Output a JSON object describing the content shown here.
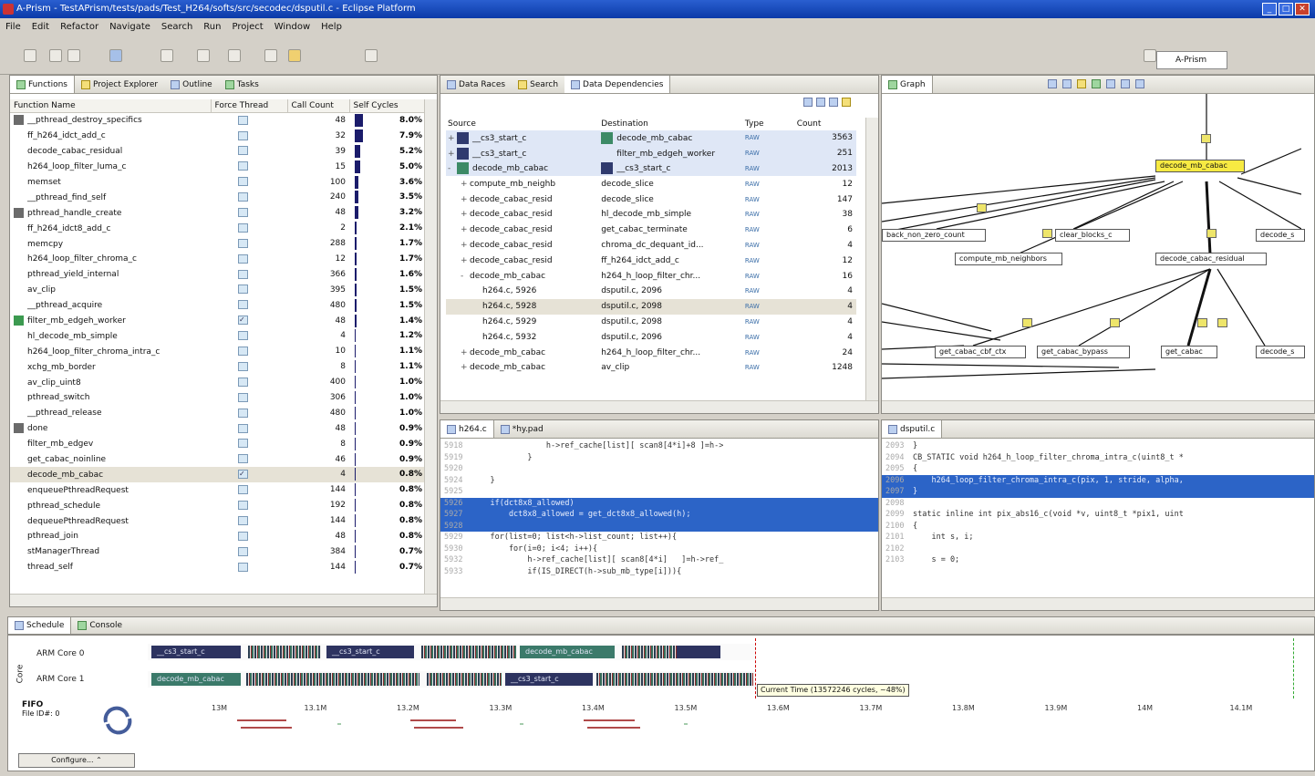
{
  "window": {
    "title": "A-Prism - TestAPrism/tests/pads/Test_H264/softs/src/secodec/dsputil.c - Eclipse Platform"
  },
  "menu": [
    "File",
    "Edit",
    "Refactor",
    "Navigate",
    "Search",
    "Run",
    "Project",
    "Window",
    "Help"
  ],
  "perspective": "A-Prism",
  "functions_panel": {
    "tabs": [
      "Functions",
      "Project Explorer",
      "Outline",
      "Tasks"
    ],
    "headers": [
      "Function Name",
      "Force Thread",
      "Call Count",
      "Self Cycles"
    ],
    "rows": [
      {
        "name": "__pthread_destroy_specifics",
        "color": "#6b6b6b",
        "forced": false,
        "calls": "48",
        "pct": "8.0%",
        "bar": 0.9
      },
      {
        "name": "ff_h264_idct_add_c",
        "color": "",
        "forced": false,
        "calls": "32",
        "pct": "7.9%",
        "bar": 0.88
      },
      {
        "name": "decode_cabac_residual",
        "color": "",
        "forced": false,
        "calls": "39",
        "pct": "5.2%",
        "bar": 0.58
      },
      {
        "name": "h264_loop_filter_luma_c",
        "color": "",
        "forced": false,
        "calls": "15",
        "pct": "5.0%",
        "bar": 0.56
      },
      {
        "name": "memset",
        "color": "",
        "forced": false,
        "calls": "100",
        "pct": "3.6%",
        "bar": 0.4
      },
      {
        "name": "__pthread_find_self",
        "color": "",
        "forced": false,
        "calls": "240",
        "pct": "3.5%",
        "bar": 0.39
      },
      {
        "name": "pthread_handle_create",
        "color": "#6b6b6b",
        "forced": false,
        "calls": "48",
        "pct": "3.2%",
        "bar": 0.36
      },
      {
        "name": "ff_h264_idct8_add_c",
        "color": "",
        "forced": false,
        "calls": "2",
        "pct": "2.1%",
        "bar": 0.23
      },
      {
        "name": "memcpy",
        "color": "",
        "forced": false,
        "calls": "288",
        "pct": "1.7%",
        "bar": 0.19
      },
      {
        "name": "h264_loop_filter_chroma_c",
        "color": "",
        "forced": false,
        "calls": "12",
        "pct": "1.7%",
        "bar": 0.19
      },
      {
        "name": "pthread_yield_internal",
        "color": "",
        "forced": false,
        "calls": "366",
        "pct": "1.6%",
        "bar": 0.18
      },
      {
        "name": "av_clip",
        "color": "",
        "forced": false,
        "calls": "395",
        "pct": "1.5%",
        "bar": 0.17
      },
      {
        "name": "__pthread_acquire",
        "color": "",
        "forced": false,
        "calls": "480",
        "pct": "1.5%",
        "bar": 0.17
      },
      {
        "name": "filter_mb_edgeh_worker",
        "color": "#3c9a50",
        "forced": true,
        "calls": "48",
        "pct": "1.4%",
        "bar": 0.16
      },
      {
        "name": "hl_decode_mb_simple",
        "color": "",
        "forced": false,
        "calls": "4",
        "pct": "1.2%",
        "bar": 0.13
      },
      {
        "name": "h264_loop_filter_chroma_intra_c",
        "color": "",
        "forced": false,
        "calls": "10",
        "pct": "1.1%",
        "bar": 0.12
      },
      {
        "name": "xchg_mb_border",
        "color": "",
        "forced": false,
        "calls": "8",
        "pct": "1.1%",
        "bar": 0.12
      },
      {
        "name": "av_clip_uint8",
        "color": "",
        "forced": false,
        "calls": "400",
        "pct": "1.0%",
        "bar": 0.11
      },
      {
        "name": "pthread_switch",
        "color": "",
        "forced": false,
        "calls": "306",
        "pct": "1.0%",
        "bar": 0.11
      },
      {
        "name": "__pthread_release",
        "color": "",
        "forced": false,
        "calls": "480",
        "pct": "1.0%",
        "bar": 0.11
      },
      {
        "name": "done",
        "color": "#6b6b6b",
        "forced": false,
        "calls": "48",
        "pct": "0.9%",
        "bar": 0.1
      },
      {
        "name": "filter_mb_edgev",
        "color": "",
        "forced": false,
        "calls": "8",
        "pct": "0.9%",
        "bar": 0.1
      },
      {
        "name": "get_cabac_noinline",
        "color": "",
        "forced": false,
        "calls": "46",
        "pct": "0.9%",
        "bar": 0.1
      },
      {
        "name": "decode_mb_cabac",
        "color": "",
        "forced": true,
        "calls": "4",
        "pct": "0.8%",
        "bar": 0.09,
        "selected": true
      },
      {
        "name": "enqueuePthreadRequest",
        "color": "",
        "forced": false,
        "calls": "144",
        "pct": "0.8%",
        "bar": 0.09
      },
      {
        "name": "pthread_schedule",
        "color": "",
        "forced": false,
        "calls": "192",
        "pct": "0.8%",
        "bar": 0.09
      },
      {
        "name": "dequeuePthreadRequest",
        "color": "",
        "forced": false,
        "calls": "144",
        "pct": "0.8%",
        "bar": 0.09
      },
      {
        "name": "pthread_join",
        "color": "",
        "forced": false,
        "calls": "48",
        "pct": "0.8%",
        "bar": 0.09
      },
      {
        "name": "stManagerThread",
        "color": "",
        "forced": false,
        "calls": "384",
        "pct": "0.7%",
        "bar": 0.08
      },
      {
        "name": "thread_self",
        "color": "",
        "forced": false,
        "calls": "144",
        "pct": "0.7%",
        "bar": 0.08
      }
    ]
  },
  "dd_panel": {
    "tabs": [
      "Data Races",
      "Search",
      "Data Dependencies"
    ],
    "headers": [
      "Source",
      "Destination",
      "Type",
      "Count"
    ],
    "rows": [
      {
        "exp": "+",
        "ind": 0,
        "src": "__cs3_start_c",
        "dst": "decode_mb_cabac",
        "type": "RAW",
        "count": "3563",
        "sc": "#2f3a6e",
        "dc": "#3c8a66",
        "hl": true
      },
      {
        "exp": "+",
        "ind": 0,
        "src": "__cs3_start_c",
        "dst": "filter_mb_edgeh_worker",
        "type": "RAW",
        "count": "251",
        "sc": "#2f3a6e",
        "dc": "",
        "hl": true
      },
      {
        "exp": "-",
        "ind": 0,
        "src": "decode_mb_cabac",
        "dst": "__cs3_start_c",
        "type": "RAW",
        "count": "2013",
        "sc": "#3c8a66",
        "dc": "#2f3a6e",
        "hl": true
      },
      {
        "exp": "+",
        "ind": 1,
        "src": "compute_mb_neighb",
        "dst": "decode_slice",
        "type": "RAW",
        "count": "12"
      },
      {
        "exp": "+",
        "ind": 1,
        "src": "decode_cabac_resid",
        "dst": "decode_slice",
        "type": "RAW",
        "count": "147"
      },
      {
        "exp": "+",
        "ind": 1,
        "src": "decode_cabac_resid",
        "dst": "hl_decode_mb_simple",
        "type": "RAW",
        "count": "38"
      },
      {
        "exp": "+",
        "ind": 1,
        "src": "decode_cabac_resid",
        "dst": "get_cabac_terminate",
        "type": "RAW",
        "count": "6"
      },
      {
        "exp": "+",
        "ind": 1,
        "src": "decode_cabac_resid",
        "dst": "chroma_dc_dequant_id...",
        "type": "RAW",
        "count": "4"
      },
      {
        "exp": "+",
        "ind": 1,
        "src": "decode_cabac_resid",
        "dst": "ff_h264_idct_add_c",
        "type": "RAW",
        "count": "12"
      },
      {
        "exp": "-",
        "ind": 1,
        "src": "decode_mb_cabac",
        "dst": "h264_h_loop_filter_chr...",
        "type": "RAW",
        "count": "16"
      },
      {
        "exp": "",
        "ind": 2,
        "src": "h264.c, 5926",
        "dst": "dsputil.c, 2096",
        "type": "RAW",
        "count": "4"
      },
      {
        "exp": "",
        "ind": 2,
        "src": "h264.c, 5928",
        "dst": "dsputil.c, 2098",
        "type": "RAW",
        "count": "4",
        "sel": true
      },
      {
        "exp": "",
        "ind": 2,
        "src": "h264.c, 5929",
        "dst": "dsputil.c, 2098",
        "type": "RAW",
        "count": "4"
      },
      {
        "exp": "",
        "ind": 2,
        "src": "h264.c, 5932",
        "dst": "dsputil.c, 2096",
        "type": "RAW",
        "count": "4"
      },
      {
        "exp": "+",
        "ind": 1,
        "src": "decode_mb_cabac",
        "dst": "h264_h_loop_filter_chr...",
        "type": "RAW",
        "count": "24"
      },
      {
        "exp": "+",
        "ind": 1,
        "src": "decode_mb_cabac",
        "dst": "av_clip",
        "type": "RAW",
        "count": "1248"
      }
    ]
  },
  "graph_panel": {
    "tab": "Graph",
    "nodes": [
      "decode_mb_cabac",
      "back_non_zero_count",
      "clear_blocks_c",
      "compute_mb_neighbors",
      "decode_cabac_residual",
      "decode_s",
      "get_cabac_cbf_ctx",
      "get_cabac_bypass",
      "get_cabac",
      "decode_s"
    ]
  },
  "editor_h264": {
    "tabs": [
      "h264.c",
      "*hy.pad"
    ],
    "lines": [
      {
        "n": "5918",
        "t": "                h->ref_cache[list][ scan8[4*i]+8 ]=h->"
      },
      {
        "n": "5919",
        "t": "            }"
      },
      {
        "n": "5920",
        "t": ""
      },
      {
        "n": "5924",
        "t": "    }"
      },
      {
        "n": "5925",
        "t": ""
      },
      {
        "n": "5926",
        "t": "    if(dct8x8_allowed)",
        "hl": true
      },
      {
        "n": "5927",
        "t": "        dct8x8_allowed = get_dct8x8_allowed(h);",
        "hl": true
      },
      {
        "n": "5928",
        "t": "",
        "hl": true
      },
      {
        "n": "5929",
        "t": "    for(list=0; list<h->list_count; list++){"
      },
      {
        "n": "5930",
        "t": "        for(i=0; i<4; i++){"
      },
      {
        "n": "5932",
        "t": "            h->ref_cache[list][ scan8[4*i]   ]=h->ref_"
      },
      {
        "n": "5933",
        "t": "            if(IS_DIRECT(h->sub_mb_type[i])){"
      }
    ]
  },
  "editor_dsputil": {
    "tabs": [
      "dsputil.c"
    ],
    "lines": [
      {
        "n": "2093",
        "t": "}"
      },
      {
        "n": "2094",
        "t": "CB_STATIC void h264_h_loop_filter_chroma_intra_c(uint8_t *"
      },
      {
        "n": "2095",
        "t": "{"
      },
      {
        "n": "2096",
        "t": "    h264_loop_filter_chroma_intra_c(pix, 1, stride, alpha,",
        "hl": true
      },
      {
        "n": "2097",
        "t": "}",
        "hl": true
      },
      {
        "n": "2098",
        "t": ""
      },
      {
        "n": "2099",
        "t": "static inline int pix_abs16_c(void *v, uint8_t *pix1, uint"
      },
      {
        "n": "2100",
        "t": "{"
      },
      {
        "n": "2101",
        "t": "    int s, i;"
      },
      {
        "n": "2102",
        "t": ""
      },
      {
        "n": "2103",
        "t": "    s = 0;"
      }
    ]
  },
  "schedule": {
    "tabs": [
      "Schedule",
      "Console"
    ],
    "cores": [
      "ARM Core 0",
      "ARM Core 1"
    ],
    "core_axis_label": "Core",
    "core0_segments": [
      "__cs3_start_c",
      "__cs3_start_c",
      "decode_mb_cabac"
    ],
    "core1_segments": [
      "decode_mb_cabac",
      "__cs3_start_c"
    ],
    "tooltip": "Current Time (13572246 cycles, ~48%)",
    "ticks": [
      "13M",
      "13.1M",
      "13.2M",
      "13.3M",
      "13.4M",
      "13.5M",
      "13.6M",
      "13.7M",
      "13.8M",
      "13.9M",
      "14M",
      "14.1M"
    ],
    "fifo_label": "FIFO",
    "fifo_value": "File ID#: 0",
    "configure": "Configure..."
  }
}
